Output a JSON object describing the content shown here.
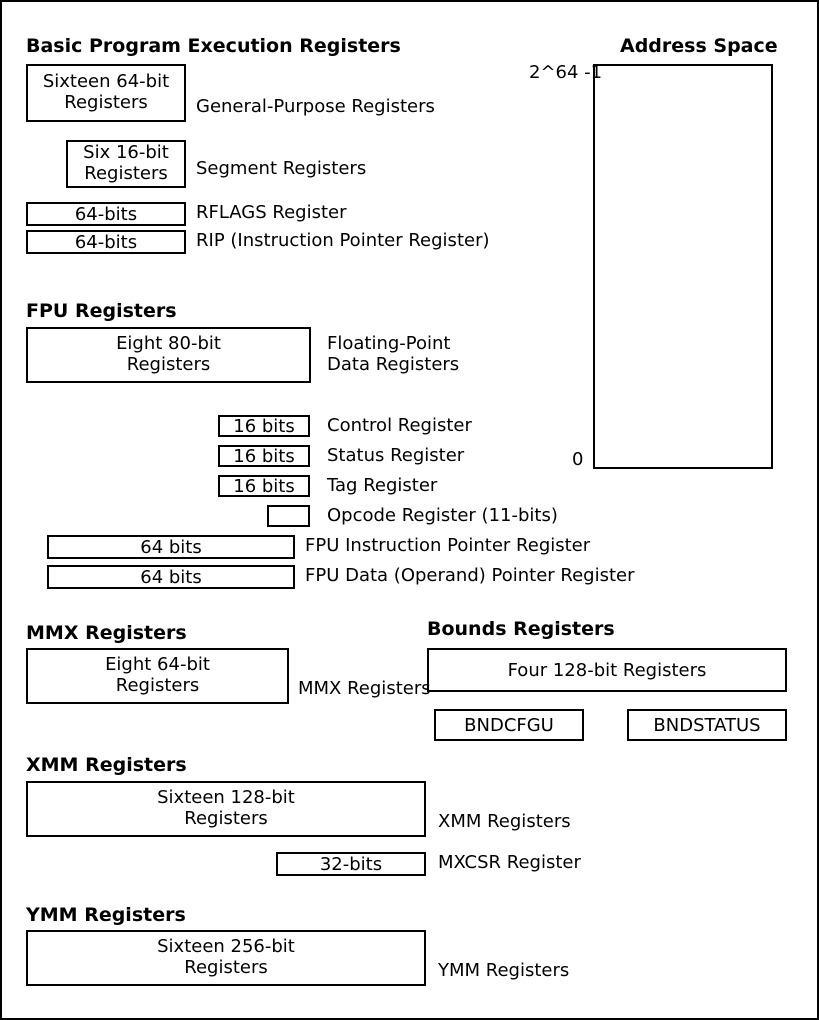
{
  "addressSpace": {
    "title": "Address Space",
    "top": "2^64 -1",
    "bottom": "0"
  },
  "basic": {
    "heading": "Basic Program Execution Registers",
    "gpr": {
      "box1": "Sixteen 64-bit",
      "box2": "Registers",
      "label": "General-Purpose Registers"
    },
    "seg": {
      "box1": "Six 16-bit",
      "box2": "Registers",
      "label": "Segment Registers"
    },
    "rflags": {
      "box": "64-bits",
      "label": "RFLAGS Register"
    },
    "rip": {
      "box": "64-bits",
      "label": "RIP (Instruction Pointer Register)"
    }
  },
  "fpu": {
    "heading": "FPU Registers",
    "data": {
      "box1": "Eight 80-bit",
      "box2": "Registers",
      "label1": "Floating-Point",
      "label2": "Data Registers"
    },
    "ctrl": {
      "box": "16 bits",
      "label": "Control Register"
    },
    "status": {
      "box": "16 bits",
      "label": "Status Register"
    },
    "tag": {
      "box": "16 bits",
      "label": "Tag Register"
    },
    "opcode": {
      "label": "Opcode Register (11-bits)"
    },
    "ip": {
      "box": "64 bits",
      "label": "FPU Instruction Pointer Register"
    },
    "dp": {
      "box": "64 bits",
      "label": "FPU Data (Operand) Pointer Register"
    }
  },
  "mmx": {
    "heading": "MMX Registers",
    "box1": "Eight 64-bit",
    "box2": "Registers",
    "label": "MMX Registers"
  },
  "bounds": {
    "heading": "Bounds Registers",
    "box": "Four 128-bit Registers",
    "bndcfgu": "BNDCFGU",
    "bndstatus": "BNDSTATUS"
  },
  "xmm": {
    "heading": "XMM Registers",
    "box1": "Sixteen 128-bit",
    "box2": "Registers",
    "label": "XMM Registers",
    "mxcsrBox": "32-bits",
    "mxcsrLabel": "MXCSR Register"
  },
  "ymm": {
    "heading": "YMM Registers",
    "box1": "Sixteen 256-bit",
    "box2": "Registers",
    "label": "YMM Registers"
  }
}
